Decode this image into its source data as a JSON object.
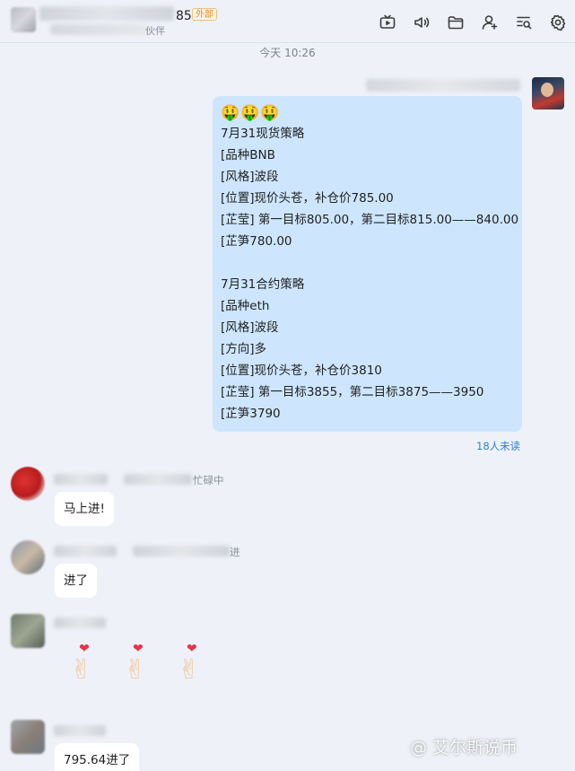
{
  "header": {
    "group_title_suffix": "85群",
    "external_badge": "外部",
    "subtitle_suffix": "伙伴",
    "icons": [
      "tv-icon",
      "speaker-icon",
      "folder-icon",
      "add-user-icon",
      "search-list-icon",
      "gear-icon"
    ]
  },
  "timestamp": "今天 10:26",
  "outgoing": {
    "emoji": "🤑🤑🤑",
    "lines": [
      "7月31现货策略",
      "[品种BNB",
      "[风格]波段",
      "[位置]现价头苍，补仓价785.00",
      "[芷莹] 第一目标805.00，第二目标815.00——840.00",
      "[芷笋780.00",
      "",
      "7月31合约策略",
      "[品种eth",
      "[风格]波段",
      "[方向]多",
      "[位置]现价头苍，补仓价3810",
      "[芷莹] 第一目标3855，第二目标3875——3950",
      "[芷笋3790"
    ],
    "read_status": "18人未读"
  },
  "incoming": [
    {
      "tag": "忙碌中",
      "text": "马上进!"
    },
    {
      "tag": "进",
      "text": "进了"
    },
    {
      "tag": "",
      "text": "🫰🫰🫰"
    },
    {
      "tag": "",
      "text": "795.64进了"
    }
  ],
  "watermark": "@ 艾尔斯说币"
}
